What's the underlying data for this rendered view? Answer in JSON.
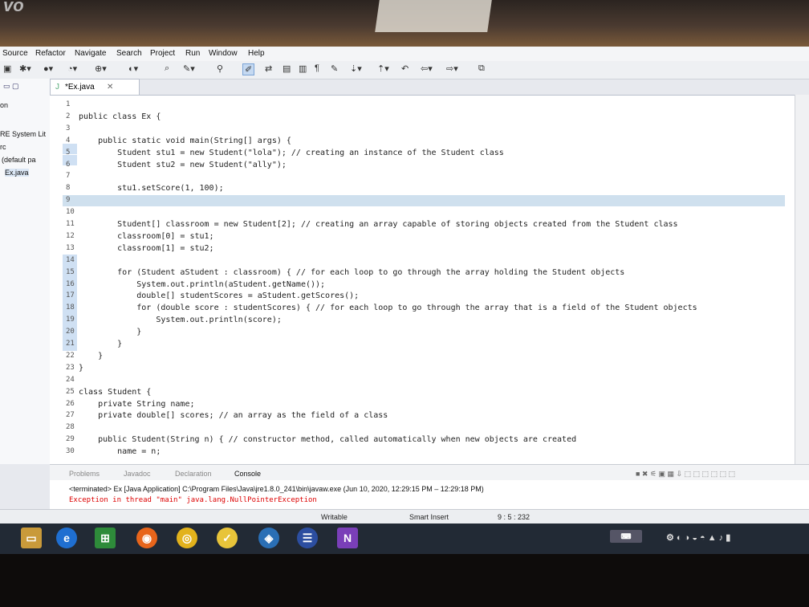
{
  "menu": [
    "Source",
    "Refactor",
    "Navigate",
    "Search",
    "Project",
    "Run",
    "Window",
    "Help"
  ],
  "left_panel": {
    "items": [
      "on",
      "RE System Lit",
      "rc",
      "(default pa",
      "Ex.java"
    ]
  },
  "editor": {
    "tab_label": "*Ex.java",
    "line_numbers": [
      "1",
      "2",
      "3",
      "4",
      "5",
      "6",
      "7",
      "8",
      "9",
      "10",
      "11",
      "12",
      "13",
      "14",
      "15",
      "16",
      "17",
      "18",
      "19",
      "20",
      "21",
      "22",
      "23",
      "24",
      "25",
      "26",
      "27",
      "28",
      "29",
      "30"
    ],
    "lines": [
      "",
      "public class Ex {",
      "",
      "    public static void main(String[] args) {",
      "        Student stu1 = new Student(\"lola\"); // creating an instance of the Student class",
      "        Student stu2 = new Student(\"ally\");",
      "",
      "        stu1.setScore(1, 100);",
      "",
      "",
      "        Student[] classroom = new Student[2]; // creating an array capable of storing objects created from the Student class",
      "        classroom[0] = stu1;",
      "        classroom[1] = stu2;",
      "",
      "        for (Student aStudent : classroom) { // for each loop to go through the array holding the Student objects",
      "            System.out.println(aStudent.getName());",
      "            double[] studentScores = aStudent.getScores();",
      "            for (double score : studentScores) { // for each loop to go through the array that is a field of the Student objects",
      "                System.out.println(score);",
      "            }",
      "        }",
      "    }",
      "}",
      "",
      "class Student {",
      "    private String name;",
      "    private double[] scores; // an array as the field of a class",
      "",
      "    public Student(String n) { // constructor method, called automatically when new objects are created",
      "        name = n;"
    ]
  },
  "console": {
    "tabs": [
      "Problems",
      "Javadoc",
      "Declaration",
      "Console"
    ],
    "terminated": "<terminated> Ex [Java Application] C:\\Program Files\\Java\\jre1.8.0_241\\bin\\javaw.exe (Jun 10, 2020, 12:29:15 PM – 12:29:18 PM)",
    "error": "Exception in thread \"main\" java.lang.NullPointerException"
  },
  "status": {
    "writable": "Writable",
    "insert_mode": "Smart Insert",
    "position": "9 : 5 : 232"
  },
  "taskbar": {
    "icons": [
      "file-explorer-icon",
      "edge-icon",
      "store-icon",
      "firefox-icon",
      "chrome-icon",
      "norton-icon",
      "netbeans-icon",
      "vpn-icon",
      "onenote-icon"
    ]
  }
}
